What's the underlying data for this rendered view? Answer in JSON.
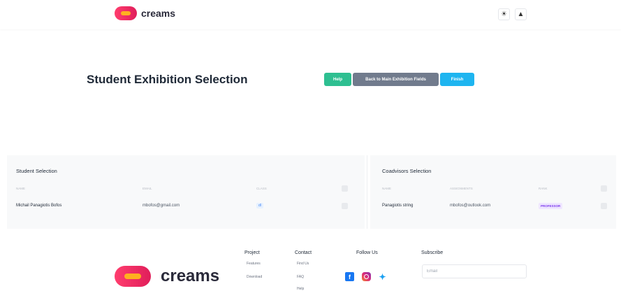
{
  "header": {
    "logo_text": "creams",
    "theme_icon": "sun-icon",
    "user_icon": "user-icon"
  },
  "page": {
    "title": "Student Exhibition Selection",
    "buttons": {
      "help": "Help",
      "back": "Back to Main Exhibition Fields",
      "finish": "Finish"
    },
    "colors": {
      "help": "#2ebf91",
      "back": "#717b8d",
      "finish": "#1eb5f0"
    }
  },
  "student_panel": {
    "title": "Student Selection",
    "columns": [
      "NAME",
      "EMAIL",
      "CLASS"
    ],
    "rows": [
      {
        "name": "Michail Panagiotis Bofos",
        "email": "mbofos@gmail.com",
        "class": "dl"
      }
    ]
  },
  "coadvisor_panel": {
    "title": "Coadvisors Selection",
    "columns": [
      "NAME",
      "ASSIGNMENTS",
      "RANK"
    ],
    "rows": [
      {
        "name": "Panagiotis string",
        "assignments": "mbofos@outlook.com",
        "rank": "PROFESSOR"
      }
    ]
  },
  "footer": {
    "logo_text": "creams",
    "project": {
      "title": "Project",
      "links": [
        "Features",
        "Download"
      ]
    },
    "contact": {
      "title": "Contact",
      "links": [
        "Find Us",
        "FAQ",
        "Help"
      ]
    },
    "follow": {
      "title": "Follow Us",
      "icons": [
        "facebook-icon",
        "instagram-icon",
        "twitter-icon"
      ]
    },
    "subscribe": {
      "title": "Subscribe",
      "placeholder": "Email"
    }
  }
}
